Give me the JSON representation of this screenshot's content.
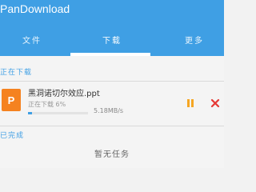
{
  "app": {
    "title": "PanDownload"
  },
  "tabs": [
    {
      "label": "文件",
      "active": false
    },
    {
      "label": "下载",
      "active": true
    },
    {
      "label": "更多",
      "active": false
    }
  ],
  "sections": {
    "active": {
      "header": "正在下载"
    },
    "done": {
      "header": "已完成"
    }
  },
  "downloads": [
    {
      "icon": "ppt-file-icon",
      "icon_letter": "P",
      "name": "黑洞诺切尔效应.ppt",
      "status": "正在下载 6%",
      "progress": 0.06,
      "speed": "5.18MB/s"
    }
  ],
  "completed": {
    "empty_text": "暂无任务"
  },
  "colors": {
    "primary": "#3f9fe4",
    "pause": "#f5a623",
    "cancel": "#e53935",
    "file_ppt": "#f58220"
  }
}
